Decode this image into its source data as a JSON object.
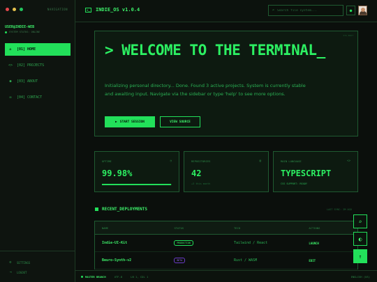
{
  "sidebar": {
    "nav_tag": "NAVIGATION",
    "user": "USER@INDIE-WEB",
    "status": "SYSTEM STATUS: ONLINE",
    "items": [
      {
        "label": "[01] HOME",
        "icon": "home-icon",
        "active": true
      },
      {
        "label": "[02] PROJECTS",
        "icon": "code-icon",
        "active": false
      },
      {
        "label": "[03] ABOUT",
        "icon": "user-icon",
        "active": false
      },
      {
        "label": "[04] CONTACT",
        "icon": "mail-icon",
        "active": false
      }
    ],
    "bottom": [
      {
        "label": "SETTINGS",
        "icon": "gear-icon"
      },
      {
        "label": "LOGOUT",
        "icon": "logout-icon"
      }
    ]
  },
  "header": {
    "title": "INDIE_OS v1.0.4",
    "search_placeholder": "Search file system..."
  },
  "hero": {
    "tag": "SYS.BOOT",
    "title": "> WELCOME TO THE TERMINAL_",
    "body": "Initializing personal directory... Done. Found 3 active projects. System is currently stable and awaiting input. Navigate via the sidebar or type 'help' to see more options.",
    "primary_button": "START SESSION",
    "secondary_button": "VIEW SOURCE"
  },
  "stats": [
    {
      "label": "UPTIME",
      "value": "99.98%",
      "progress": 0.99
    },
    {
      "label": "REPOSITORIES",
      "value": "42",
      "sub": "+3 this month"
    },
    {
      "label": "MAIN LANGUAGE",
      "value": "TYPESCRIPT",
      "sub": "CSS SUPPORT: READY"
    }
  ],
  "deployments": {
    "title": "RECENT_DEPLOYMENTS",
    "right_label": "LAST SYNC: 2M AGO",
    "columns": [
      "NAME",
      "STATUS",
      "TECH",
      "ACTIONS"
    ],
    "rows": [
      {
        "name": "Indie-UI-Kit",
        "status": "PRODUCTION",
        "tech": "Tailwind / React",
        "action": "LAUNCH"
      },
      {
        "name": "Beuro-Synth-v2",
        "status": "BETA",
        "tech": "Rust / WASM",
        "action": "EDIT"
      }
    ]
  },
  "statusbar": {
    "branch": "MASTER BRANCH",
    "encoding": "UTF-8",
    "position": "LN 1, COL 1",
    "right": "ENGLISH (US)"
  },
  "colors": {
    "accent": "#22e05a",
    "background": "#0b0f0c",
    "border": "#1f5a31",
    "beta": "#9a6bf0"
  }
}
